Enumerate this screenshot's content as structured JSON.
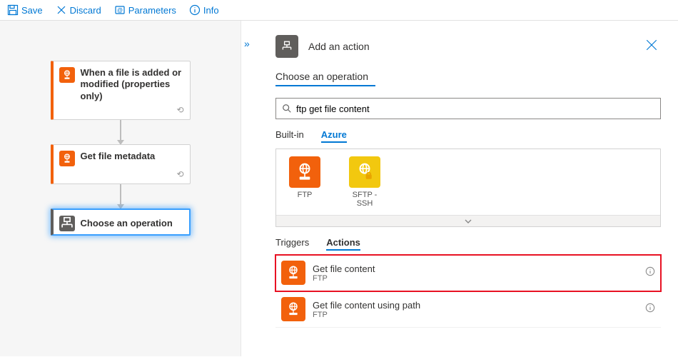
{
  "toolbar": {
    "save": "Save",
    "discard": "Discard",
    "parameters": "Parameters",
    "info": "Info"
  },
  "canvas": {
    "trigger": {
      "title": "When a file is added or modified (properties only)"
    },
    "action1": {
      "title": "Get file metadata"
    },
    "choose": {
      "title": "Choose an operation"
    }
  },
  "panel": {
    "title": "Add an action",
    "subtitle": "Choose an operation",
    "search_value": "ftp get file content",
    "tabs_scope": {
      "builtin": "Built-in",
      "azure": "Azure"
    },
    "connectors": {
      "ftp": "FTP",
      "sftp": "SFTP - SSH"
    },
    "tabs_kind": {
      "triggers": "Triggers",
      "actions": "Actions"
    },
    "actions": [
      {
        "title": "Get file content",
        "sub": "FTP"
      },
      {
        "title": "Get file content using path",
        "sub": "FTP"
      }
    ]
  }
}
